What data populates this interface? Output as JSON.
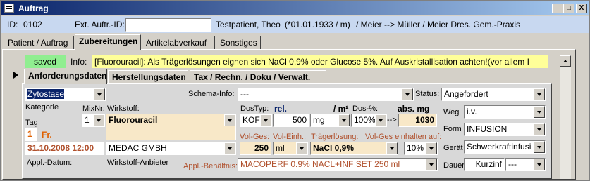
{
  "window": {
    "title": "Auftrag",
    "buttons": [
      "_",
      "□",
      "X"
    ]
  },
  "header": {
    "id_label": "ID:",
    "id_value": "0102",
    "ext_label": "Ext. Auftr.-ID:",
    "ext_value": "",
    "patient": "Testpatient, Theo",
    "birth": "(*01.01.1933 / m)",
    "route": "/  Meier --> Müller / Meier Dres. Gem.-Praxis"
  },
  "tabs": [
    {
      "label": "Patient / Auftrag"
    },
    {
      "label": "Zubereitungen"
    },
    {
      "label": "Artikelabverkauf"
    },
    {
      "label": "Sonstiges"
    }
  ],
  "status_strip": {
    "saved": "saved",
    "info_label": "Info:",
    "info_text": "[Fluorouracil]: Als Trägerlösungen eignen sich NaCl 0,9% oder Glucose 5%. Auf Auskristallisation achten!(vor allem I"
  },
  "subtabs": [
    {
      "label": "Anforderungsdaten"
    },
    {
      "label": "Herstellungsdaten"
    },
    {
      "label": "Tax / Rechn. / Doku / Verwalt."
    }
  ],
  "form": {
    "kategorie_value": "Zytostase",
    "kategorie_label": "Kategorie",
    "mixnr_label": "MixNr:",
    "mixnr_value": "1",
    "wirkstoff_label": "Wirkstoff:",
    "wirkstoff_value": "Fluorouracil",
    "tag_label": "Tag",
    "tag_value": "1",
    "tag_day": "Fr.",
    "appl_datum_value": "31.10.2008  12:00",
    "appl_datum_label": "Appl.-Datum:",
    "anbieter_value": "MEDAC GMBH",
    "anbieter_label": "Wirkstoff-Anbieter",
    "schema_label": "Schema-Info:",
    "schema_value": "---",
    "status_label": "Status:",
    "status_value": "Angefordert",
    "dostyp_label": "DosTyp:",
    "rel_label": "rel.",
    "m2_label": "/ m²",
    "dos_pct_label": "Dos-%:",
    "abs_label": "abs. mg",
    "dostyp_value": "KOF",
    "dose_value": "500",
    "unit_value": "mg",
    "pct_value": "100%",
    "arrow": "-->",
    "abs_value": "1030",
    "volges_label": "Vol-Ges:",
    "voleinh_label": "Vol-Einh.:",
    "traeger_label": "Trägerlösung:",
    "vol_einhalten_label": "Vol-Ges einhalten auf:",
    "volges_value": "250",
    "voleinh_value": "ml",
    "traeger_value": "NaCl 0,9%",
    "vol_einhalten_value": "10%",
    "behaeltnis_label": "Appl.-Behältnis:",
    "behaeltnis_value": "MACOPERF 0.9% NACL+INF SET 250 ml",
    "weg_label": "Weg",
    "weg_value": "i.v.",
    "form_label": "Form",
    "form_value": "INFUSION",
    "geraet_label": "Gerät",
    "geraet_value": "Schwerkraftinfusi",
    "dauer_label": "Dauer",
    "dauer_value": "Kurzinf",
    "dauer_unit": "---"
  },
  "colors": {
    "titlebar_start": "#0a246a",
    "titlebar_end": "#a6caf0",
    "infobar": "#c8d8f0",
    "saved_bg": "#90ee90",
    "info_bg": "#ffff99",
    "beige": "#f8e8c8",
    "brown_label": "#b0502c"
  }
}
